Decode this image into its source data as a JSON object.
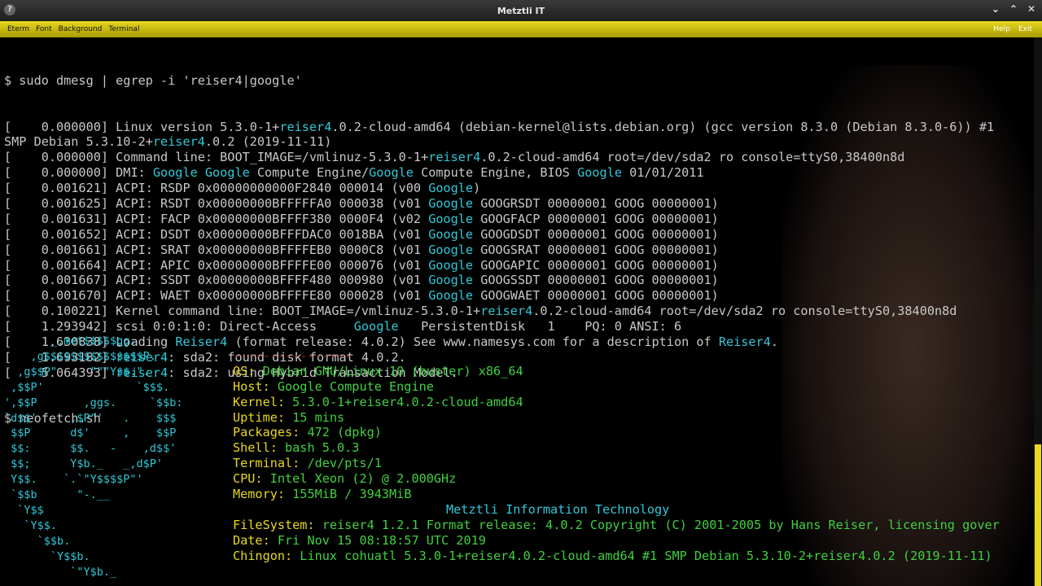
{
  "window": {
    "title": "Metztli IT",
    "help": "Help",
    "exit": "Exit"
  },
  "menu": [
    "Eterm",
    "Font",
    "Background",
    "Terminal"
  ],
  "cmd1": "$ sudo dmesg | egrep -i 'reiser4|google'",
  "dmesg": [
    [
      "[    0.000000] Linux version 5.3.0-1+",
      "reiser4",
      ".0.2-cloud-amd64 (debian-kernel@lists.debian.org) (gcc version 8.3.0 (Debian 8.3.0-6)) #1"
    ],
    [
      "SMP Debian 5.3.10-2+",
      "reiser4",
      ".0.2 (2019-11-11)"
    ],
    [
      "[    0.000000] Command line: BOOT_IMAGE=/vmlinuz-5.3.0-1+",
      "reiser4",
      ".0.2-cloud-amd64 root=/dev/sda2 ro console=ttyS0,38400n8d"
    ],
    [
      "[    0.000000] DMI: ",
      "Google Google",
      " Compute Engine/",
      "Google",
      " Compute Engine, BIOS ",
      "Google",
      " 01/01/2011"
    ],
    [
      "[    0.001621] ACPI: RSDP 0x00000000000F2840 000014 (v00 ",
      "Google",
      ")"
    ],
    [
      "[    0.001625] ACPI: RSDT 0x00000000BFFFFFA0 000038 (v01 ",
      "Google",
      " GOOGRSDT 00000001 GOOG 00000001)"
    ],
    [
      "[    0.001631] ACPI: FACP 0x00000000BFFFF380 0000F4 (v02 ",
      "Google",
      " GOOGFACP 00000001 GOOG 00000001)"
    ],
    [
      "[    0.001652] ACPI: DSDT 0x00000000BFFFDAC0 0018BA (v01 ",
      "Google",
      " GOOGDSDT 00000001 GOOG 00000001)"
    ],
    [
      "[    0.001661] ACPI: SRAT 0x00000000BFFFFEB0 0000C8 (v01 ",
      "Google",
      " GOOGSRAT 00000001 GOOG 00000001)"
    ],
    [
      "[    0.001664] ACPI: APIC 0x00000000BFFFFE00 000076 (v01 ",
      "Google",
      " GOOGAPIC 00000001 GOOG 00000001)"
    ],
    [
      "[    0.001667] ACPI: SSDT 0x00000000BFFFF480 000980 (v01 ",
      "Google",
      " GOOGSSDT 00000001 GOOG 00000001)"
    ],
    [
      "[    0.001670] ACPI: WAET 0x00000000BFFFFE80 000028 (v01 ",
      "Google",
      " GOOGWAET 00000001 GOOG 00000001)"
    ],
    [
      "[    0.100221] Kernel command line: BOOT_IMAGE=/vmlinuz-5.3.0-1+",
      "reiser4",
      ".0.2-cloud-amd64 root=/dev/sda2 ro console=ttyS0,38400n8d"
    ],
    [
      "[    1.293942] scsi 0:0:1:0: Direct-Access     ",
      "Google",
      "   PersistentDisk   1    PQ: 0 ANSI: 6"
    ],
    [
      "[    1.630838] Loading ",
      "Reiser4",
      " (format release: 4.0.2) See www.namesys.com for a description of ",
      "Reiser4",
      "."
    ],
    [
      "[    1.693182] ",
      "reiser4",
      ": sda2: found disk format 4.0.2."
    ],
    [
      "[    5.064393] ",
      "reiser4",
      ": sda2: using Hybrid Transaction Model."
    ]
  ],
  "cmd2": "$ neofetch.sh",
  "ascii": "       _,met$$$$$gg.\n    ,g$$$$$$$$$$$$$$$P.\n  ,g$$P\"     \"\"\"Y$$.\".\n ,$$P'              `$$$.\n',$$P       ,ggs.     `$$b:\n`d$$'     ,$P\"'   .    $$$\n $$P      d$'     ,    $$P\n $$:      $$.   -    ,d$$'\n $$;      Y$b._   _,d$P'\n Y$$.    `.`\"Y$$$$P\"'\n `$$b      \"-.__\n  `Y$$\n   `Y$$.\n     `$$b.\n       `Y$$b.\n          `\"Y$b._",
  "info_sep": "----------------",
  "info": [
    [
      "OS",
      "Debian GNU/Linux 10 (buster) x86_64"
    ],
    [
      "Host",
      "Google Compute Engine"
    ],
    [
      "Kernel",
      "5.3.0-1+reiser4.0.2-cloud-amd64"
    ],
    [
      "Uptime",
      "15 mins"
    ],
    [
      "Packages",
      "472 (dpkg)"
    ],
    [
      "Shell",
      "bash 5.0.3"
    ],
    [
      "Terminal",
      "/dev/pts/1"
    ],
    [
      "CPU",
      "Intel Xeon (2) @ 2.000GHz"
    ],
    [
      "Memory",
      "155MiB / 3943MiB"
    ]
  ],
  "org": "Metztli Information Technology",
  "info2": [
    [
      "FileSystem",
      "reiser4 1.2.1 Format release: 4.0.2 Copyright (C) 2001-2005 by Hans Reiser, licensing gover"
    ],
    [
      "Date",
      "Fri Nov 15 08:18:57 UTC 2019"
    ],
    [
      "Chingon",
      "Linux cohuatl 5.3.0-1+reiser4.0.2-cloud-amd64 #1 SMP Debian 5.3.10-2+reiser4.0.2 (2019-11-11)"
    ]
  ]
}
